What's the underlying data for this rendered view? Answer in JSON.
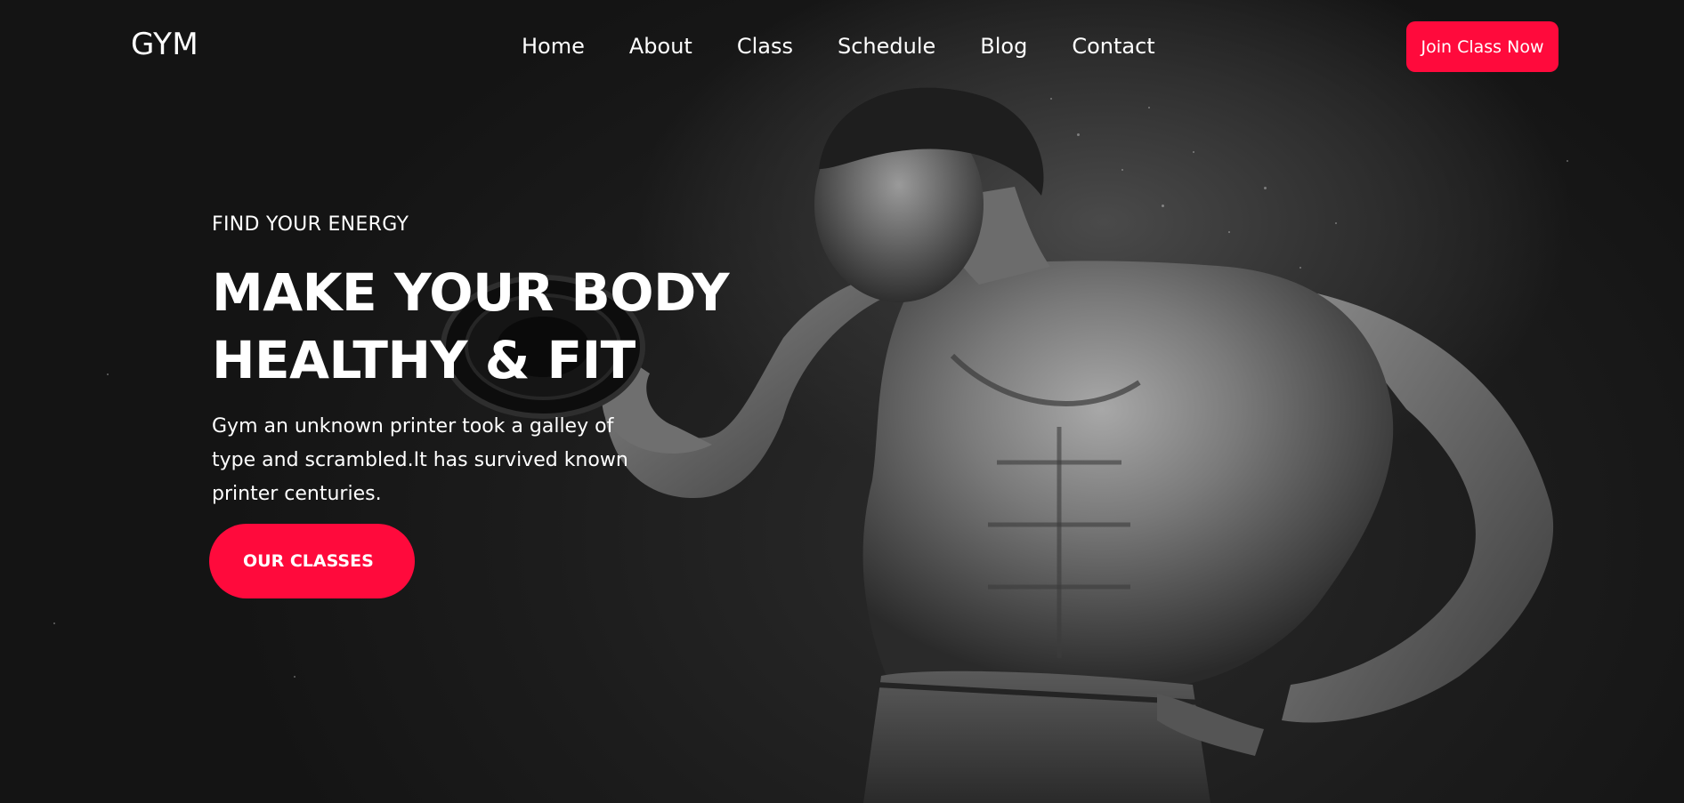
{
  "header": {
    "logo": "GYM",
    "nav": [
      {
        "label": "Home"
      },
      {
        "label": "About"
      },
      {
        "label": "Class"
      },
      {
        "label": "Schedule"
      },
      {
        "label": "Blog"
      },
      {
        "label": "Contact"
      }
    ],
    "cta_label": "Join Class Now"
  },
  "hero": {
    "eyebrow": "FIND YOUR ENERGY",
    "headline_line1": "MAKE YOUR BODY",
    "headline_line2": "HEALTHY & FIT",
    "description": "Gym an unknown printer took a galley of type and scrambled.It has survived known printer centuries.",
    "button_label": "OUR CLASSES",
    "image": "muscular-man-lifting-dumbbell"
  },
  "colors": {
    "accent": "#ff0a3c",
    "background": "#141414",
    "text": "#ffffff"
  }
}
